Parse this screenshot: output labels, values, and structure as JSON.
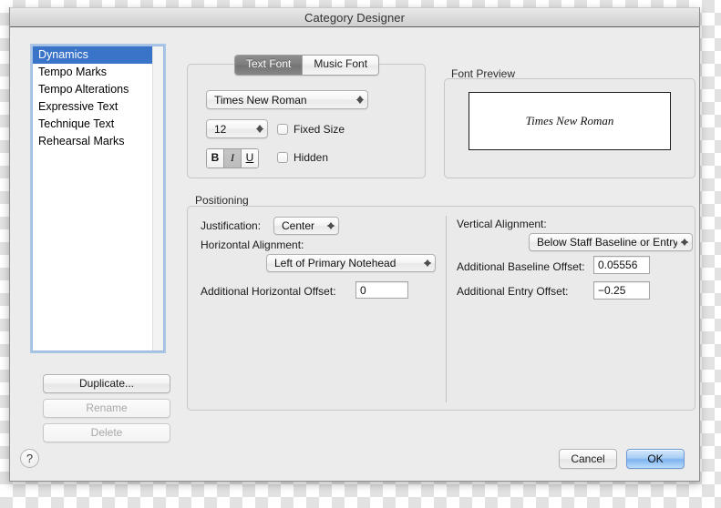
{
  "window": {
    "title": "Category Designer"
  },
  "category_list": {
    "items": [
      {
        "label": "Dynamics",
        "selected": true
      },
      {
        "label": "Tempo Marks",
        "selected": false
      },
      {
        "label": "Tempo Alterations",
        "selected": false
      },
      {
        "label": "Expressive Text",
        "selected": false
      },
      {
        "label": "Technique Text",
        "selected": false
      },
      {
        "label": "Rehearsal Marks",
        "selected": false
      }
    ]
  },
  "side_buttons": {
    "duplicate": "Duplicate...",
    "rename": "Rename",
    "delete": "Delete"
  },
  "font_group": {
    "tabs": [
      {
        "label": "Text Font",
        "active": true
      },
      {
        "label": "Music Font",
        "active": false
      }
    ],
    "font_family": "Times New Roman",
    "font_size": "12",
    "fixed_size_label": "Fixed Size",
    "fixed_size_checked": false,
    "hidden_label": "Hidden",
    "hidden_checked": false,
    "style": {
      "bold": "B",
      "italic": "I",
      "underline": "U",
      "bold_on": false,
      "italic_on": true,
      "underline_on": false
    }
  },
  "preview": {
    "label": "Font Preview",
    "sample_text": "Times New Roman"
  },
  "positioning": {
    "label": "Positioning",
    "justification_label": "Justification:",
    "justification_value": "Center",
    "horizontal_alignment_label": "Horizontal Alignment:",
    "horizontal_alignment_value": "Left of Primary Notehead",
    "horizontal_offset_label": "Additional Horizontal Offset:",
    "horizontal_offset_value": "0",
    "vertical_alignment_label": "Vertical Alignment:",
    "vertical_alignment_value": "Below Staff Baseline or Entry",
    "baseline_offset_label": "Additional Baseline Offset:",
    "baseline_offset_value": "0.05556",
    "entry_offset_label": "Additional Entry Offset:",
    "entry_offset_value": "−0.25"
  },
  "footer": {
    "help": "?",
    "cancel": "Cancel",
    "ok": "OK"
  },
  "colors": {
    "selection_blue": "#3a74c8",
    "default_button_blue": "#7cb3ef",
    "window_bg": "#ececec",
    "group_bg": "#eaeaea"
  }
}
